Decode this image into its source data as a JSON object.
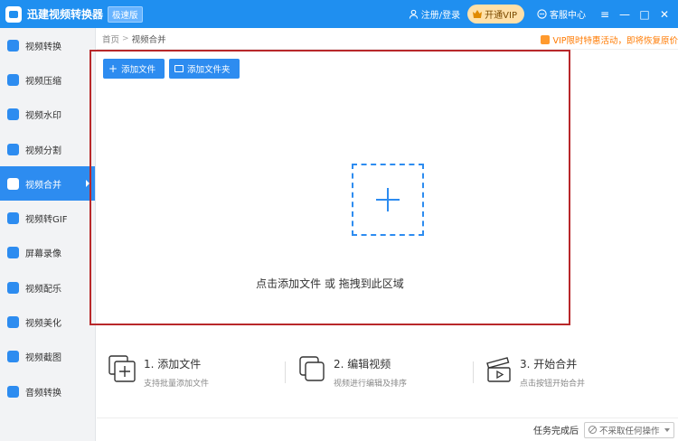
{
  "titlebar": {
    "app_title": "迅建视频转换器",
    "edition": "极速版",
    "login": "注册/登录",
    "vip_button": "开通VIP",
    "support": "客服中心",
    "controls": {
      "menu": "≡",
      "minimize": "—",
      "maximize": "□",
      "close": "✕"
    }
  },
  "sidebar": {
    "items": [
      {
        "label": "视频转换",
        "icon": "video-convert-icon"
      },
      {
        "label": "视频压缩",
        "icon": "video-compress-icon"
      },
      {
        "label": "视频水印",
        "icon": "video-watermark-icon"
      },
      {
        "label": "视频分割",
        "icon": "video-split-icon"
      },
      {
        "label": "视频合并",
        "icon": "video-merge-icon",
        "active": true
      },
      {
        "label": "视频转GIF",
        "icon": "video-gif-icon"
      },
      {
        "label": "屏幕录像",
        "icon": "screen-record-icon"
      },
      {
        "label": "视频配乐",
        "icon": "video-music-icon"
      },
      {
        "label": "视频美化",
        "icon": "video-beautify-icon"
      },
      {
        "label": "视频截图",
        "icon": "video-screenshot-icon"
      },
      {
        "label": "音频转换",
        "icon": "audio-convert-icon"
      }
    ]
  },
  "breadcrumb": {
    "home": "首页",
    "separator": ">",
    "current": "视频合并"
  },
  "promo": {
    "text": "VIP限时特惠活动，即将恢复原价"
  },
  "toolbar": {
    "add_file": "添加文件",
    "add_folder": "添加文件夹"
  },
  "drop_area": {
    "hint": "点击添加文件 或 拖拽到此区域"
  },
  "steps": [
    {
      "title": "1. 添加文件",
      "desc": "支持批量添加文件"
    },
    {
      "title": "2. 编辑视频",
      "desc": "视频进行编辑及排序"
    },
    {
      "title": "3. 开始合并",
      "desc": "点击按钮开始合并"
    }
  ],
  "footer": {
    "label": "任务完成后",
    "select_value": "不采取任何操作"
  },
  "colors": {
    "primary": "#2d8cf0",
    "titlebar": "#1f8ff0",
    "frame": "#b8282a",
    "promo": "#ff7a00"
  }
}
